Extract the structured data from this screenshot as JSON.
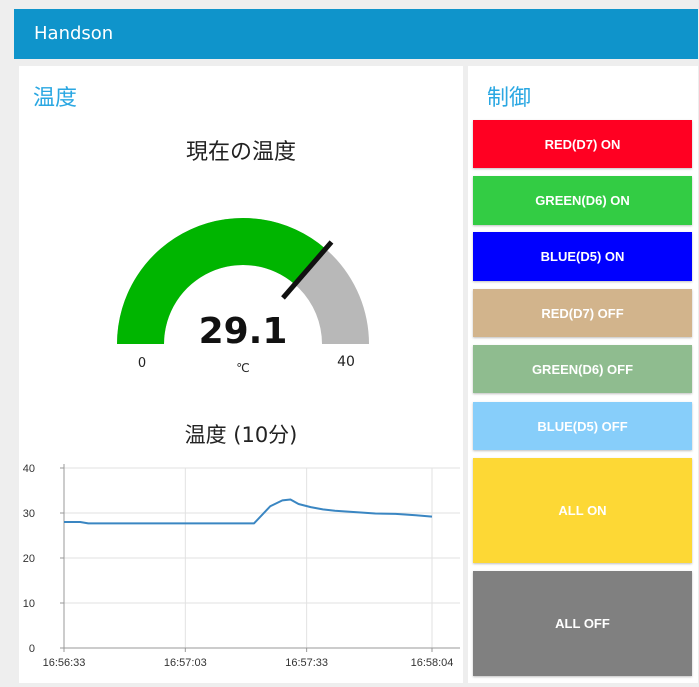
{
  "header": {
    "title": "Handson"
  },
  "temperature_group": {
    "title": "温度",
    "gauge": {
      "title": "現在の温度",
      "value": 29.1,
      "value_label": "29.1",
      "unit": "℃",
      "min": 0,
      "max": 40,
      "min_label": "0",
      "max_label": "40",
      "fill_color": "#00b500",
      "track_color": "#b8b8b8",
      "needle_color": "#111111"
    },
    "chart": {
      "title": "温度 (10分)"
    }
  },
  "control_group": {
    "title": "制御",
    "buttons": [
      {
        "label": "RED(D7) ON",
        "color": "#ff0022"
      },
      {
        "label": "GREEN(D6) ON",
        "color": "#33cc44"
      },
      {
        "label": "BLUE(D5) ON",
        "color": "#0000ff"
      },
      {
        "label": "RED(D7) OFF",
        "color": "#d2b48c"
      },
      {
        "label": "GREEN(D6) OFF",
        "color": "#8fbc8f"
      },
      {
        "label": "BLUE(D5) OFF",
        "color": "#87cefa"
      },
      {
        "label": "ALL ON",
        "color": "#fdd835"
      },
      {
        "label": "ALL OFF",
        "color": "#808080"
      }
    ]
  },
  "chart_data": {
    "type": "line",
    "title": "温度 (10分)",
    "xlabel": "",
    "ylabel": "",
    "ylim": [
      0,
      40
    ],
    "yticks": [
      "0",
      "10",
      "20",
      "30",
      "40"
    ],
    "xticks": [
      "16:56:33",
      "16:57:03",
      "16:57:33",
      "16:58:04"
    ],
    "grid": true,
    "series": [
      {
        "color": "#3a86c2",
        "x": [
          "16:56:33",
          "16:56:37",
          "16:56:39",
          "16:56:55",
          "16:57:10",
          "16:57:20",
          "16:57:24",
          "16:57:27",
          "16:57:29",
          "16:57:31",
          "16:57:34",
          "16:57:37",
          "16:57:40",
          "16:57:45",
          "16:57:50",
          "16:57:55",
          "16:58:00",
          "16:58:04"
        ],
        "values": [
          28,
          28,
          27.7,
          27.7,
          27.7,
          27.7,
          31.5,
          32.8,
          33.0,
          32.0,
          31.3,
          30.8,
          30.5,
          30.2,
          29.9,
          29.8,
          29.5,
          29.2
        ]
      }
    ]
  }
}
